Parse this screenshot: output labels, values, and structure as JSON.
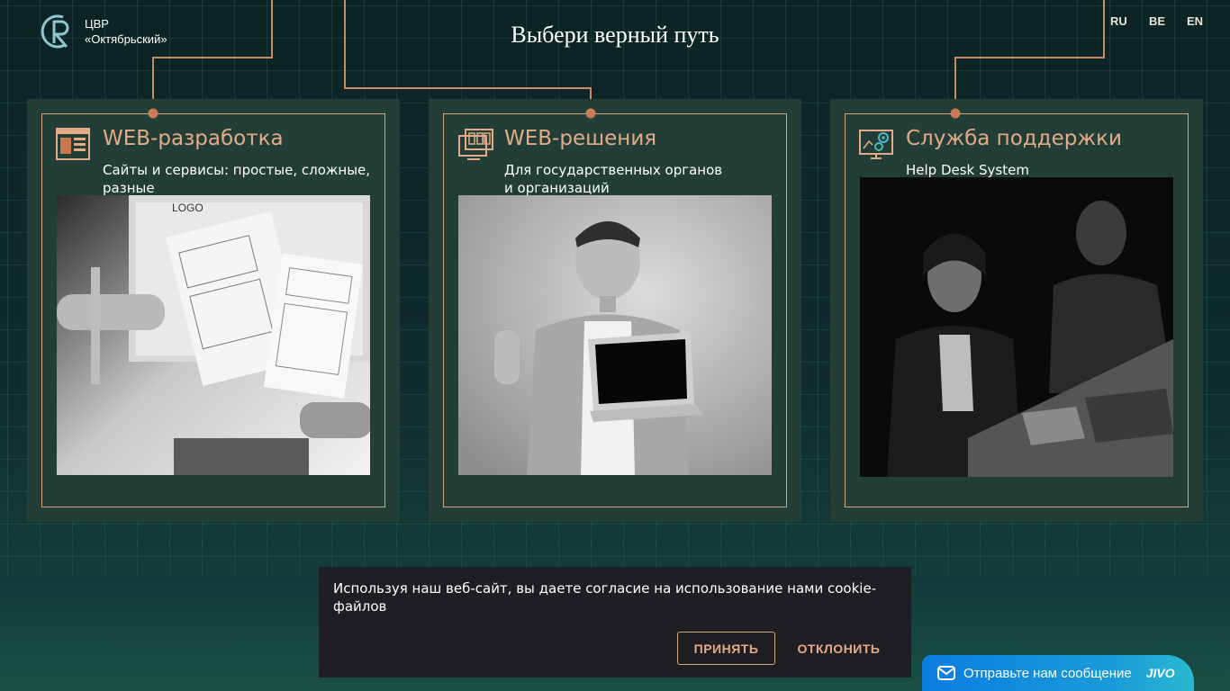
{
  "header": {
    "logo_line1": "ЦВР",
    "logo_line2": "«Октябрьский»",
    "title": "Выбери верный путь",
    "languages": [
      "RU",
      "BE",
      "EN"
    ]
  },
  "cards": [
    {
      "title": "WEB-разработка",
      "subtitle": "Сайты и сервисы: простые, сложные, разные",
      "icon": "web-layout-icon",
      "photo": "designer-hands-with-wireframes-photo"
    },
    {
      "title": "WEB-решения",
      "subtitle": "Для государственных органов и организаций",
      "icon": "multi-window-icon",
      "photo": "smiling-man-with-laptop-photo"
    },
    {
      "title": "Служба поддержки",
      "subtitle": "Help Desk System",
      "icon": "monitor-gears-icon",
      "photo": "support-team-working-at-night-photo"
    }
  ],
  "cookie": {
    "text": "Используя наш веб-сайт, вы даете согласие на использование нами cookie-файлов",
    "accept": "ПРИНЯТЬ",
    "decline": "ОТКЛОНИТЬ"
  },
  "chat": {
    "text": "Отправьте нам сообщение",
    "brand": "JIVO",
    "icon": "message-icon"
  },
  "colors": {
    "accent": "#e3ab88",
    "card_bg": "#223e37",
    "chat_blue": "#0b7de0"
  }
}
